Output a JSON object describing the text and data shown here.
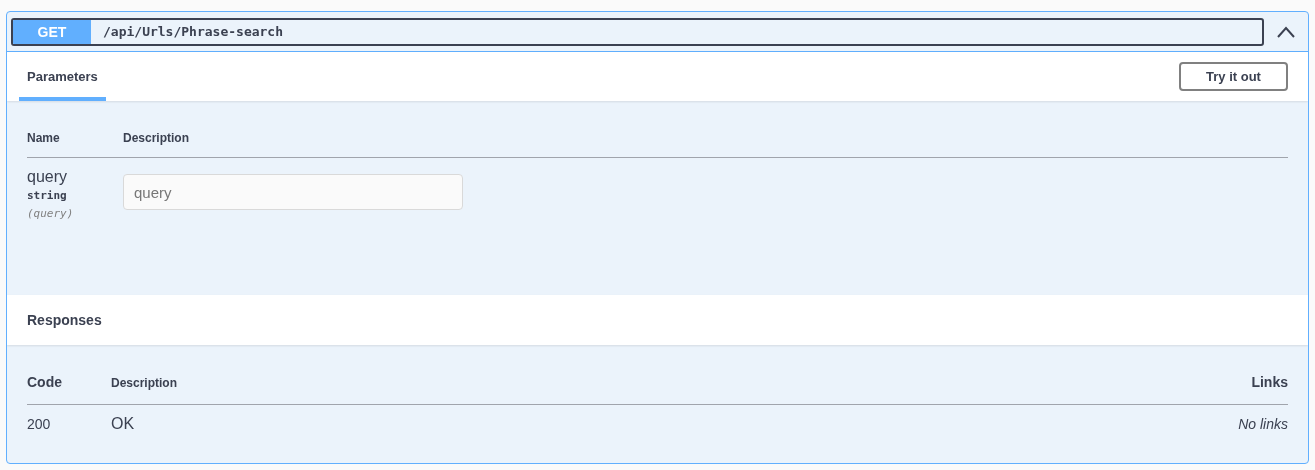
{
  "operation": {
    "method": "GET",
    "path": "/api/Urls/Phrase-search",
    "expanded": true
  },
  "parameters_section": {
    "tabs": [
      {
        "label": "Parameters",
        "selected": true
      }
    ],
    "try_button": "Try it out",
    "columns": [
      "Name",
      "Description"
    ],
    "rows": [
      {
        "name": "query",
        "type": "string",
        "location": "(query)",
        "placeholder": "query"
      }
    ]
  },
  "responses_section": {
    "title": "Responses",
    "columns": [
      "Code",
      "Description",
      "Links"
    ],
    "rows": [
      {
        "code": "200",
        "description": "OK",
        "links": "No links"
      }
    ]
  }
}
